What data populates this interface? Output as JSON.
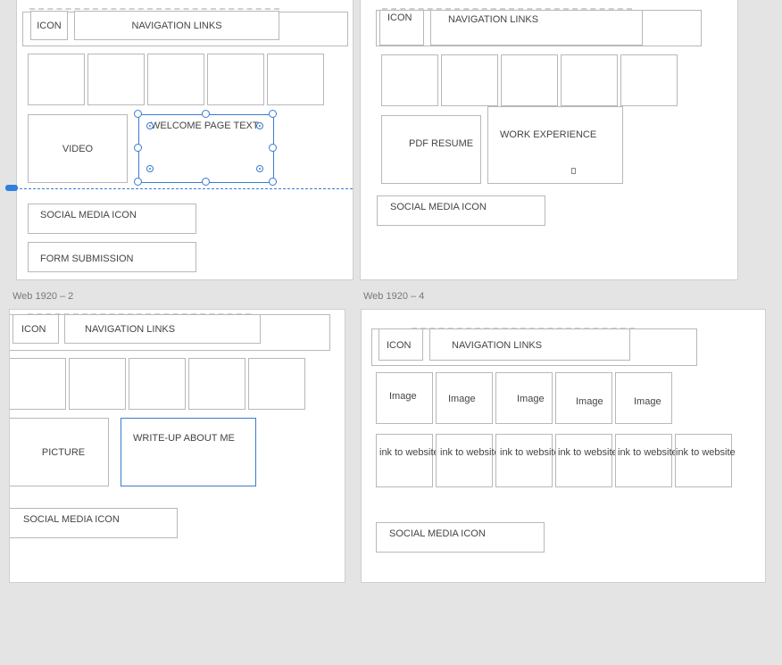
{
  "artboard_labels": {
    "ab2": "Web 1920 – 2",
    "ab4": "Web 1920 – 4"
  },
  "common": {
    "icon": "ICON",
    "nav": "NAVIGATION LINKS",
    "social": "SOCIAL MEDIA ICON"
  },
  "ab1": {
    "video": "VIDEO",
    "welcome": "WELCOME PAGE TEXT",
    "form": "FORM SUBMISSION"
  },
  "ab3": {
    "pdf": "PDF RESUME",
    "work": "WORK EXPERIENCE"
  },
  "ab2": {
    "picture": "PICTURE",
    "writeup": "WRITE-UP ABOUT ME"
  },
  "ab4": {
    "images": [
      "Image",
      "Image",
      "Image",
      "Image",
      "Image"
    ],
    "links": [
      "ink to website",
      "ink to website",
      "ink to website",
      "ink to website",
      "ink to website",
      "ink to website"
    ]
  },
  "colors": {
    "selection": "#3b7bd1",
    "canvas": "#e4e4e4",
    "artboard": "#ffffff"
  }
}
